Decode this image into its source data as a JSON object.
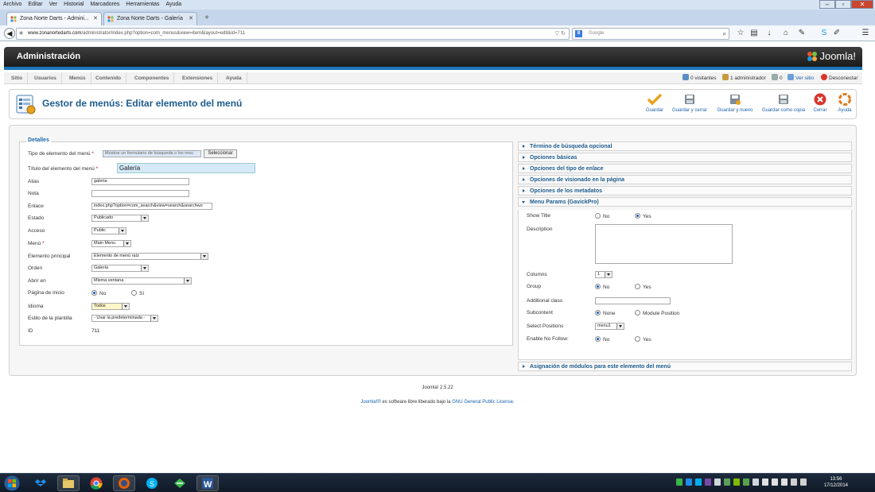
{
  "firefox": {
    "menu": [
      "Archivo",
      "Editar",
      "Ver",
      "Historial",
      "Marcadores",
      "Herramientas",
      "Ayuda"
    ],
    "tabs": [
      {
        "label": "Zona Norte Darts - Admini...",
        "active": true
      },
      {
        "label": "Zona Norte Darts - Galería",
        "active": false
      }
    ],
    "new_tab": "+",
    "url_host": "www.zonanortedarts.com",
    "url_path": "/administrator/index.php?option=com_menus&view=item&layout=edit&id=711",
    "search_placeholder": "Google"
  },
  "joomla": {
    "title": "Administración",
    "logo_text": "Joomla!",
    "menu": [
      "Sitio",
      "Usuarios",
      "Menús",
      "Contenido",
      "Componentes",
      "Extensiones",
      "Ayuda"
    ],
    "status": {
      "visitors": "0 visitantes",
      "admins": "1 administrador",
      "messages": "0",
      "view_site": "Ver sitio",
      "logout": "Desconectar"
    }
  },
  "toolbar": {
    "page_title": "Gestor de menús: Editar elemento del menú",
    "buttons": {
      "save": "Guardar",
      "save_close": "Guardar y cerrar",
      "save_new": "Guardar y nuevo",
      "save_copy": "Guardar como copia",
      "close": "Cerrar",
      "help": "Ayuda"
    }
  },
  "details": {
    "legend": "Detalles",
    "menu_type_label": "Tipo de elemento del menú",
    "menu_type_value": "Mostrar un formulario de búsqueda o los resu",
    "select_button": "Seleccionar",
    "title_label": "Título del elemento del menú",
    "title_value": "Galería",
    "alias_label": "Alias",
    "alias_value": "galeria",
    "note_label": "Nota",
    "note_value": "",
    "link_label": "Enlace",
    "link_value": "index.php?option=com_search&view=search&searchwo",
    "state_label": "Estado",
    "state_value": "Publicado",
    "access_label": "Acceso",
    "access_value": "Public",
    "menu_label": "Menú",
    "menu_value": "Main Menu",
    "parent_label": "Elemento principal",
    "parent_value": "Elemento de menú raíz",
    "order_label": "Orden",
    "order_value": "Galería",
    "open_label": "Abrir en",
    "open_value": "Misma ventana",
    "home_label": "Página de inicio",
    "home_no": "No",
    "home_yes": "Sí",
    "language_label": "Idioma",
    "language_value": "Todos",
    "template_label": "Estilo de la plantilla",
    "template_value": "- Usar la predeterminada -",
    "id_label": "ID",
    "id_value": "711",
    "required_mark": "*"
  },
  "accordion": {
    "items": [
      "Término de búsqueda opcional",
      "Opciones básicas",
      "Opciones del tipo de enlace",
      "Opciones de visionado en la página",
      "Opciones de los metadatos",
      "Menu Params (GavickPro)"
    ],
    "modules": "Asignación de módulos para este elemento del menú"
  },
  "menu_params": {
    "show_title_label": "Show Title",
    "description_label": "Description",
    "columns_label": "Columns",
    "columns_value": "1",
    "group_label": "Group",
    "additional_class_label": "Additional class",
    "subcontent_label": "Subcontent",
    "subcontent_none": "None",
    "subcontent_module": "Module Position",
    "select_positions_label": "Select Positions",
    "select_positions_value": "menu1",
    "nofollow_label": "Enable No Follow:",
    "no": "No",
    "yes": "Yes"
  },
  "footer": {
    "version": "Joomla! 2.5.22",
    "license_link1": "Joomla!®",
    "license_text": " es software libre liberado bajo la ",
    "license_link2": "GNU General Public License",
    "license_end": "."
  },
  "taskbar": {
    "time": "13:56",
    "date": "17/12/2014"
  },
  "colors": {
    "accent": "#1c5b8d",
    "header_bar": "#1d76b8",
    "save_check": "#e8a21f",
    "close_red": "#d9342b",
    "help_orange": "#e07b1f"
  }
}
